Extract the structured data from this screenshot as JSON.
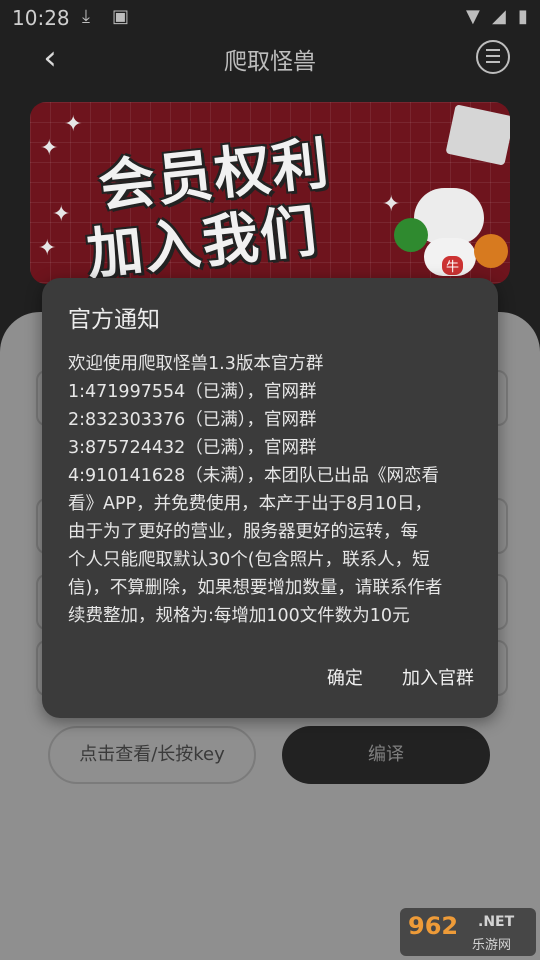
{
  "status_bar": {
    "time": "10:28"
  },
  "app_bar": {
    "title": "爬取怪兽"
  },
  "banner": {
    "line1": "会员权利",
    "line2": "加入我们",
    "badge": "牛"
  },
  "buttons": {
    "view_key": "点击查看/长按key",
    "compile": "编译"
  },
  "dialog": {
    "title": "官方通知",
    "lines": [
      "欢迎使用爬取怪兽1.3版本官方群",
      "1:471997554（已满），官网群",
      "2:832303376（已满），官网群",
      "3:875724432（已满），官网群",
      "4:910141628（未满），本团队已出品《网恋看",
      "看》APP，并免费使用，本产于出于8月10日，",
      "由于为了更好的营业，服务器更好的运转，每",
      "个人只能爬取默认30个(包含照片，联系人，短",
      "信)，不算删除，如果想要增加数量，请联系作者",
      "续费整加，规格为:每增加100文件数为10元"
    ],
    "confirm": "确定",
    "join": "加入官群"
  },
  "watermark": {
    "logo": "962",
    "net": ".NET",
    "sub": "乐游网"
  }
}
